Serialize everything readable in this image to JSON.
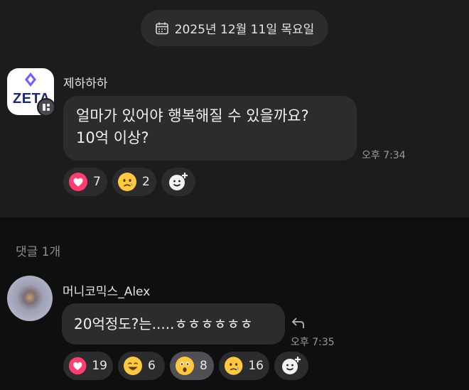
{
  "date_header": {
    "icon": "calendar-icon",
    "text": "2025년 12월 11일 목요일"
  },
  "post": {
    "author": "제하하하",
    "avatar_logo_text": "ZETA",
    "lines": [
      "얼마가 있어야 행복해질 수 있을까요?",
      "10억 이상?"
    ],
    "time": "오후 7:34",
    "reactions": [
      {
        "icon": "heart-icon",
        "count": "7"
      },
      {
        "icon": "sad-face-icon",
        "count": "2"
      }
    ],
    "add_reaction_icon": "add-reaction-icon"
  },
  "comments_header": "댓글 1개",
  "comment": {
    "author": "머니코믹스_Alex",
    "text": "20억정도?는.....ㅎㅎㅎㅎㅎㅎ",
    "time": "오후 7:35",
    "reply_icon": "reply-arrow-icon",
    "reactions": [
      {
        "icon": "heart-icon",
        "count": "19"
      },
      {
        "icon": "laughing-face-icon",
        "count": "6"
      },
      {
        "icon": "surprised-face-icon",
        "count": "8",
        "selected": true
      },
      {
        "icon": "sad-face-icon",
        "count": "16"
      }
    ],
    "add_reaction_icon": "add-reaction-icon"
  },
  "colors": {
    "background": "#0f0f10",
    "post_background": "#1c1c1e",
    "bubble": "#2c2c2f",
    "heart": "#ff3d6e",
    "emoji": "#ffc83d"
  }
}
